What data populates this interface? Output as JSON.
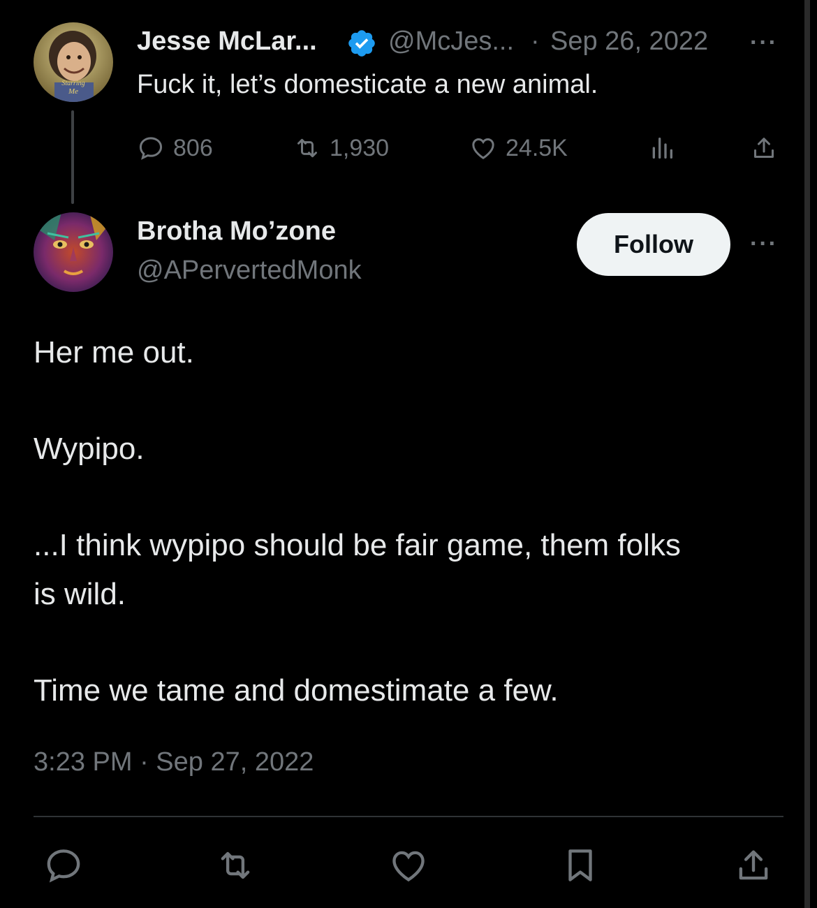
{
  "parent_tweet": {
    "author_name": "Jesse McLar...",
    "handle": "@McJes...",
    "separator": "·",
    "date": "Sep 26, 2022",
    "more": "···",
    "avatar_caption_1": "Starring",
    "avatar_caption_2": "Me",
    "text": "Fuck it, let’s domesticate a new animal.",
    "stats": {
      "replies": "806",
      "retweets": "1,930",
      "likes": "24.5K"
    }
  },
  "main_tweet": {
    "author_name": "Brotha Mo’zone",
    "handle": "@APervertedMonk",
    "follow_label": "Follow",
    "more": "···",
    "paragraphs": [
      "Her me out.",
      "Wypipo.",
      "...I think wypipo should be fair game, them folks",
      "is wild.",
      "Time we tame and domestimate a few."
    ],
    "timestamp": "3:23 PM · Sep 27, 2022"
  },
  "colors": {
    "background": "#000000",
    "text": "#e7e9ea",
    "muted": "#71767b",
    "verified": "#1d9bf0",
    "follow_bg": "#eff3f4"
  }
}
